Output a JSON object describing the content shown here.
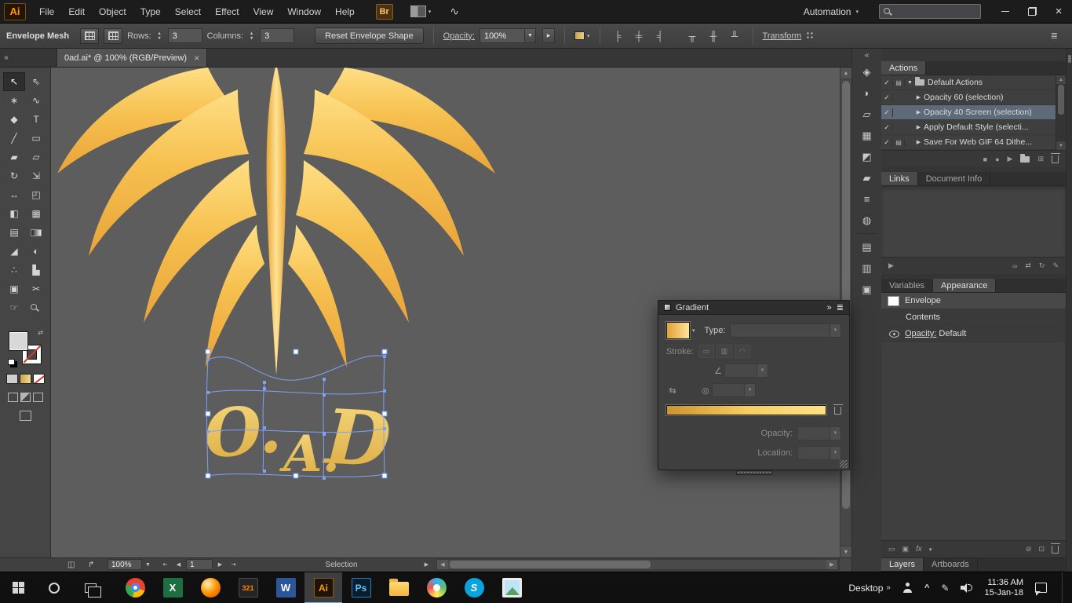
{
  "titlebar": {
    "logo": "Ai",
    "menus": [
      "File",
      "Edit",
      "Object",
      "Type",
      "Select",
      "Effect",
      "View",
      "Window",
      "Help"
    ],
    "bridge": "Br",
    "workspace": "Automation",
    "search_value": ""
  },
  "icons": {
    "dropdown": "▾",
    "spin_up": "▲",
    "spin_down": "▼",
    "collapse": "«",
    "expand": "»",
    "panel_menu": "≣",
    "tri_right": "▶",
    "tri_down": "▼",
    "check": "✓",
    "stop": "■",
    "record": "●",
    "play": "▶",
    "new_item": "⊞",
    "up": "▲",
    "down": "▼",
    "left": "◀",
    "right": "▶",
    "first": "⇤",
    "last": "⇥",
    "close": "×",
    "infinity": "∞",
    "swap": "⇄",
    "refresh": "↻",
    "edit": "✎",
    "angle": "∠",
    "ratio": "◎",
    "reverse": "⇆",
    "fx": "fx",
    "caret": "^",
    "chevrons": "»",
    "swirl": "∿",
    "st1": "◫",
    "st2": "↱",
    "align_icons": [
      "╞",
      "╪",
      "╡",
      "╥",
      "╫",
      "╨"
    ]
  },
  "controlbar": {
    "context_label": "Envelope Mesh",
    "rows_label": "Rows:",
    "rows_value": "3",
    "columns_label": "Columns:",
    "columns_value": "3",
    "reset_button": "Reset Envelope Shape",
    "opacity_label": "Opacity:",
    "opacity_value": "100%",
    "transform_label": "Transform"
  },
  "tabbar": {
    "document": "0ad.ai* @ 100% (RGB/Preview)"
  },
  "tools": {
    "items": [
      {
        "name": "selection",
        "glyph": "↖"
      },
      {
        "name": "direct-selection",
        "glyph": "⇖"
      },
      {
        "name": "magic-wand",
        "glyph": "∗"
      },
      {
        "name": "lasso",
        "glyph": "∿"
      },
      {
        "name": "pen",
        "glyph": "◆"
      },
      {
        "name": "type",
        "glyph": "T"
      },
      {
        "name": "line",
        "glyph": "╱"
      },
      {
        "name": "rectangle",
        "glyph": "▭"
      },
      {
        "name": "paintbrush",
        "glyph": "▰"
      },
      {
        "name": "pencil",
        "glyph": "▱"
      },
      {
        "name": "rotate",
        "glyph": "↻"
      },
      {
        "name": "scale",
        "glyph": "⇲"
      },
      {
        "name": "width",
        "glyph": "↔"
      },
      {
        "name": "free-transform",
        "glyph": "◰"
      },
      {
        "name": "shape-builder",
        "glyph": "◧"
      },
      {
        "name": "perspective-grid",
        "glyph": "▦"
      },
      {
        "name": "mesh",
        "glyph": "▤"
      },
      {
        "name": "gradient",
        "glyph": ""
      },
      {
        "name": "eyedropper",
        "glyph": "◢"
      },
      {
        "name": "blend",
        "glyph": "◐"
      },
      {
        "name": "symbol-sprayer",
        "glyph": "∴"
      },
      {
        "name": "column-graph",
        "glyph": "▙"
      },
      {
        "name": "artboard",
        "glyph": "▣"
      },
      {
        "name": "slice",
        "glyph": "✂"
      },
      {
        "name": "hand",
        "glyph": "☞"
      },
      {
        "name": "zoom",
        "glyph": ""
      }
    ]
  },
  "artwork": {
    "text_o": "O.",
    "text_a": "A.",
    "text_d": "D"
  },
  "dock": {
    "icons": [
      {
        "name": "symbols",
        "glyph": "◈"
      },
      {
        "name": "pathfinder",
        "glyph": "◗"
      },
      {
        "name": "transform",
        "glyph": "▱"
      },
      {
        "name": "swatches",
        "glyph": "▦"
      },
      {
        "name": "color-guide",
        "glyph": "◩"
      },
      {
        "name": "brushes",
        "glyph": "▰"
      },
      {
        "name": "paragraph",
        "glyph": "≡"
      },
      {
        "name": "navigator",
        "glyph": "◍"
      },
      {
        "name": "libraries",
        "glyph": "▤"
      },
      {
        "name": "info",
        "glyph": "▥"
      },
      {
        "name": "image-trace",
        "glyph": "▣"
      }
    ]
  },
  "actions": {
    "tab": "Actions",
    "folder_row": {
      "label": "Default Actions"
    },
    "rows": [
      {
        "label": "Opacity 60 (selection)"
      },
      {
        "label": "Opacity 40 Screen (selection)"
      },
      {
        "label": "Apply Default Style (selecti..."
      },
      {
        "label": "Save For Web GIF 64 Dithe..."
      }
    ]
  },
  "links": {
    "tab_links": "Links",
    "tab_docinfo": "Document Info"
  },
  "appearance": {
    "tab_variables": "Variables",
    "tab_appearance": "Appearance",
    "row1": "Envelope",
    "row2": "Contents",
    "row3_label": "Opacity:",
    "row3_value": "Default"
  },
  "layers": {
    "tab_layers": "Layers",
    "tab_artboards": "Artboards"
  },
  "gradient_panel": {
    "title": "Gradient",
    "type_label": "Type:",
    "type_value": "",
    "stroke_label": "Stroke:",
    "opacity_label": "Opacity:",
    "location_label": "Location:"
  },
  "statusbar": {
    "zoom": "100%",
    "artboard": "1",
    "status": "Selection"
  },
  "taskbar": {
    "desktop": "Desktop",
    "time": "11:36 AM",
    "date": "15-Jan-18",
    "apps": [
      {
        "name": "chrome",
        "label": ""
      },
      {
        "name": "excel",
        "label": "X"
      },
      {
        "name": "firefox",
        "label": ""
      },
      {
        "name": "video-321",
        "label": "321"
      },
      {
        "name": "word",
        "label": "W"
      },
      {
        "name": "illustrator",
        "label": "Ai"
      },
      {
        "name": "photoshop",
        "label": "Ps"
      },
      {
        "name": "file-explorer",
        "label": ""
      },
      {
        "name": "media-app",
        "label": ""
      },
      {
        "name": "skype",
        "label": "S"
      },
      {
        "name": "photos",
        "label": ""
      }
    ]
  }
}
